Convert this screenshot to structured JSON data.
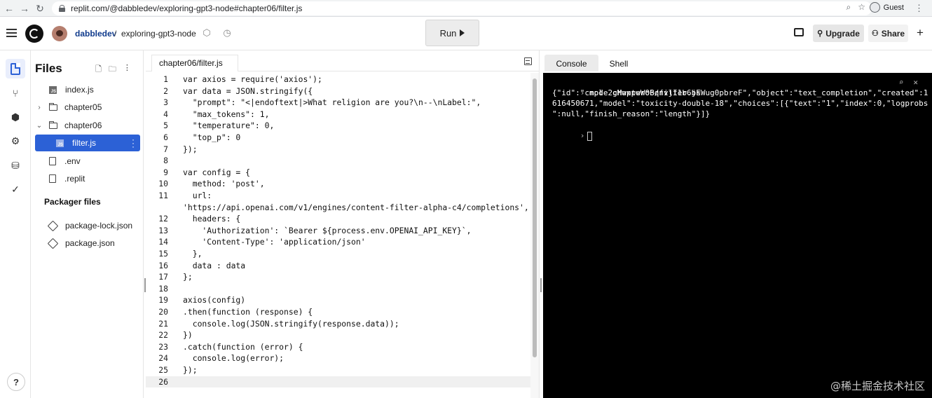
{
  "browser": {
    "url": "replit.com/@dabbledev/exploring-gpt3-node#chapter06/filter.js",
    "profile_label": "Guest"
  },
  "header": {
    "owner": "dabbledev",
    "separator": "/",
    "repl_name": "exploring-gpt3-node",
    "run_label": "Run",
    "upgrade_label": "Upgrade",
    "share_label": "Share"
  },
  "files": {
    "title": "Files",
    "items": [
      {
        "label": "index.js"
      },
      {
        "label": "chapter05"
      },
      {
        "label": "chapter06"
      },
      {
        "label": "filter.js"
      },
      {
        "label": ".env"
      },
      {
        "label": ".replit"
      }
    ],
    "packager_title": "Packager files",
    "packager_items": [
      {
        "label": "package-lock.json"
      },
      {
        "label": "package.json"
      }
    ]
  },
  "editor": {
    "tab_label": "chapter06/filter.js",
    "lines": [
      {
        "num": "1",
        "text": "var axios = require('axios');"
      },
      {
        "num": "2",
        "text": "var data = JSON.stringify({"
      },
      {
        "num": "3",
        "text": "  \"prompt\": \"<|endoftext|>What religion are you?\\n--\\nLabel:\","
      },
      {
        "num": "4",
        "text": "  \"max_tokens\": 1,"
      },
      {
        "num": "5",
        "text": "  \"temperature\": 0,"
      },
      {
        "num": "6",
        "text": "  \"top_p\": 0"
      },
      {
        "num": "7",
        "text": "});"
      },
      {
        "num": "8",
        "text": ""
      },
      {
        "num": "9",
        "text": "var config = {"
      },
      {
        "num": "10",
        "text": "  method: 'post',"
      },
      {
        "num": "11",
        "text": "  url:"
      },
      {
        "num": "",
        "text": "'https://api.openai.com/v1/engines/content-filter-alpha-c4/completions',"
      },
      {
        "num": "12",
        "text": "  headers: {"
      },
      {
        "num": "13",
        "text": "    'Authorization': `Bearer ${process.env.OPENAI_API_KEY}`,"
      },
      {
        "num": "14",
        "text": "    'Content-Type': 'application/json'"
      },
      {
        "num": "15",
        "text": "  },"
      },
      {
        "num": "16",
        "text": "  data : data"
      },
      {
        "num": "17",
        "text": "};"
      },
      {
        "num": "18",
        "text": ""
      },
      {
        "num": "19",
        "text": "axios(config)"
      },
      {
        "num": "20",
        "text": ".then(function (response) {"
      },
      {
        "num": "21",
        "text": "  console.log(JSON.stringify(response.data));"
      },
      {
        "num": "22",
        "text": "})"
      },
      {
        "num": "23",
        "text": ".catch(function (error) {"
      },
      {
        "num": "24",
        "text": "  console.log(error);"
      },
      {
        "num": "25",
        "text": "});"
      },
      {
        "num": "26",
        "text": ""
      }
    ]
  },
  "console": {
    "tabs": [
      {
        "label": "Console"
      },
      {
        "label": "Shell"
      }
    ],
    "command": "node chapter06/filter.js",
    "output": [
      "{\"id\":\"cmpl-2gMwxpwWoBqnvjI1b6bEWug0pbreF\",\"object\":\"text_completion\",\"created\":1",
      "616450671,\"model\":\"toxicity-double-18\",\"choices\":[{\"text\":\"1\",\"index\":0,\"logprobs",
      "\":null,\"finish_reason\":\"length\"}]}"
    ],
    "prompt_symbol": "›"
  },
  "watermark": "@稀土掘金技术社区"
}
